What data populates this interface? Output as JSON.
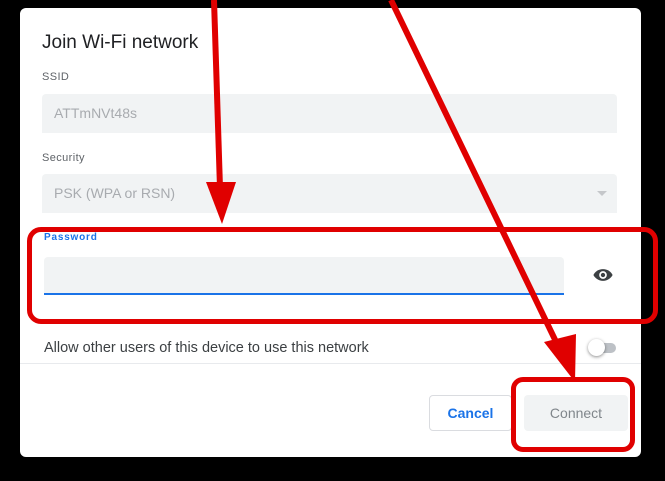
{
  "dialog": {
    "title": "Join Wi-Fi network",
    "ssid": {
      "label": "SSID",
      "value": "ATTmNVt48s"
    },
    "security": {
      "label": "Security",
      "value": "PSK (WPA or RSN)"
    },
    "password": {
      "label": "Password",
      "value": ""
    },
    "allow_others": {
      "label": "Allow other users of this device to use this network",
      "enabled": false
    },
    "buttons": {
      "cancel": "Cancel",
      "connect": "Connect"
    }
  },
  "colors": {
    "accent": "#1a73e8",
    "annotation": "#e00000",
    "field_bg": "#f1f3f4"
  },
  "icons": {
    "password_visibility": "eye-icon",
    "security_dropdown": "chevron-down-icon"
  }
}
